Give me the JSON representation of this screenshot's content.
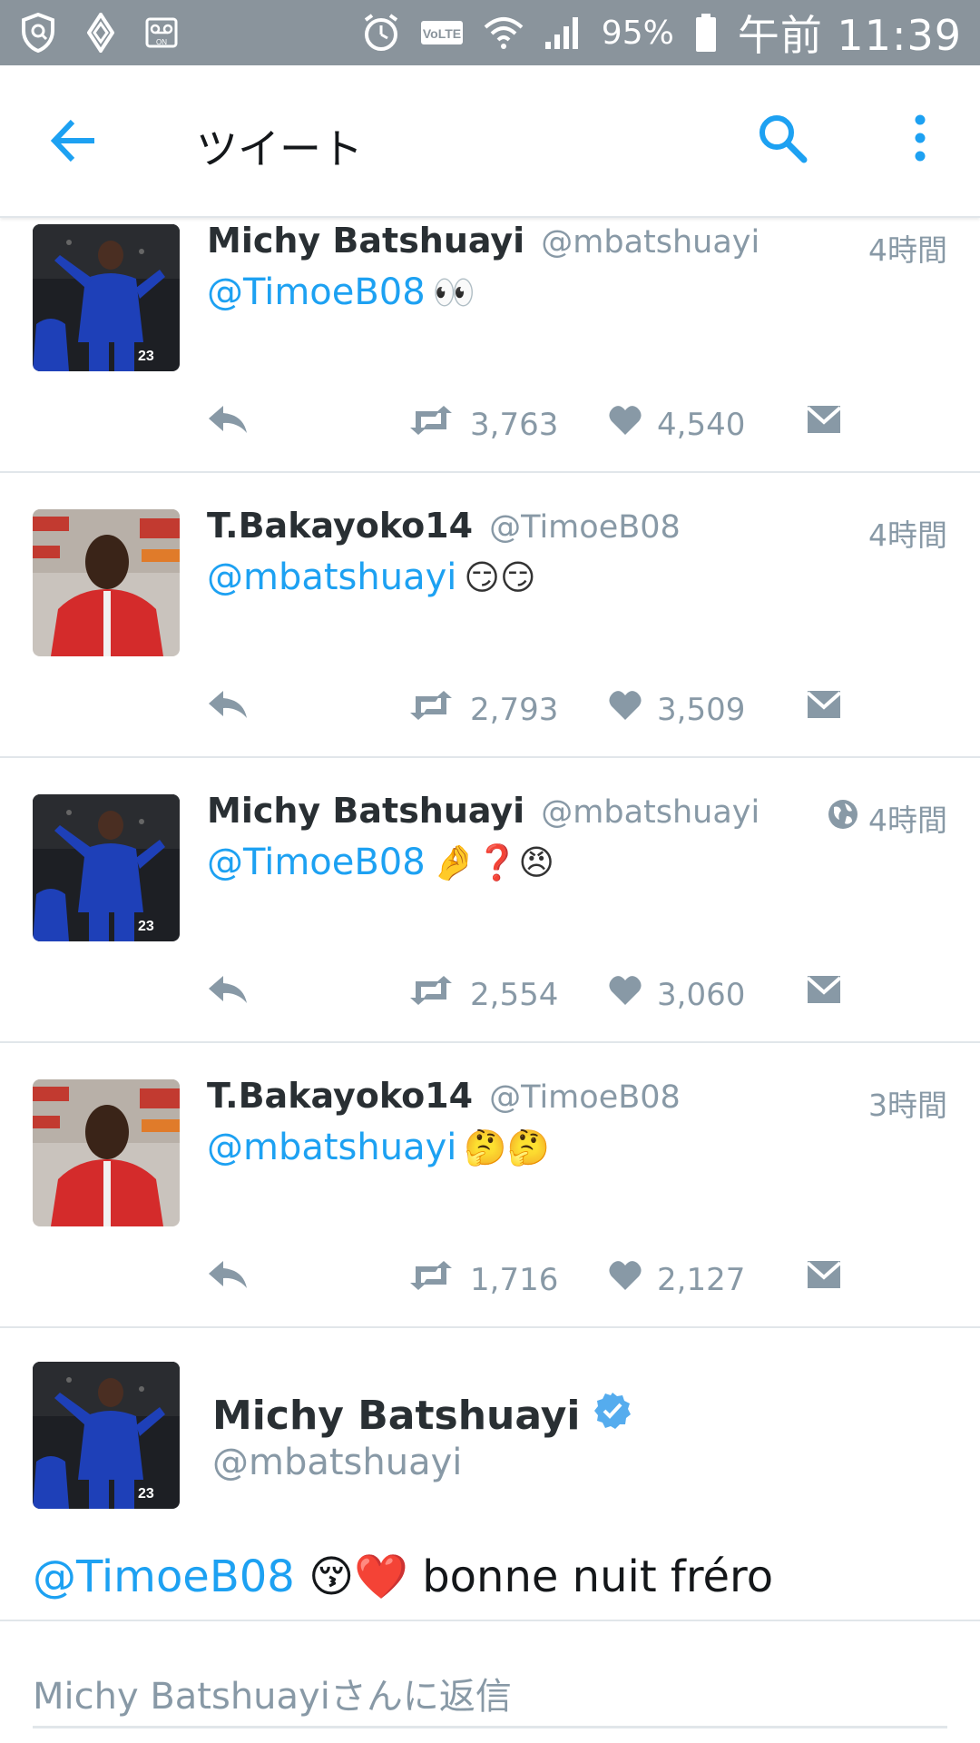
{
  "status_bar": {
    "battery_percent": "95%",
    "time": "午前 11:39"
  },
  "app_bar": {
    "title": "ツイート"
  },
  "tweets": [
    {
      "name": "Michy Batshuayi",
      "handle": "@mbatshuayi",
      "time": "4時間",
      "mention": "@TimoeB08",
      "emoji": "👀",
      "retweets": "3,763",
      "likes": "4,540",
      "avatar": "chelsea-player",
      "globe": false
    },
    {
      "name": "T.Bakayoko14",
      "handle": "@TimoeB08",
      "time": "4時間",
      "mention": "@mbatshuayi",
      "emoji": "😏😏",
      "retweets": "2,793",
      "likes": "3,509",
      "avatar": "monaco-player",
      "globe": false
    },
    {
      "name": "Michy Batshuayi",
      "handle": "@mbatshuayi",
      "time": "4時間",
      "mention": "@TimoeB08",
      "emoji": "🤌❓😠",
      "retweets": "2,554",
      "likes": "3,060",
      "avatar": "chelsea-player",
      "globe": true
    },
    {
      "name": "T.Bakayoko14",
      "handle": "@TimoeB08",
      "time": "3時間",
      "mention": "@mbatshuayi",
      "emoji": "🤔🤔",
      "retweets": "1,716",
      "likes": "2,127",
      "avatar": "monaco-player",
      "globe": false
    }
  ],
  "main_tweet": {
    "name": "Michy Batshuayi",
    "handle": "@mbatshuayi",
    "mention": "@TimoeB08",
    "emoji": "😚❤️",
    "text": "bonne nuit fréro"
  },
  "reply": {
    "placeholder": "Michy Batshuayiさんに返信"
  },
  "colors": {
    "accent": "#1da1f2",
    "muted": "#8899a6",
    "status_bar": "#8a949c"
  }
}
